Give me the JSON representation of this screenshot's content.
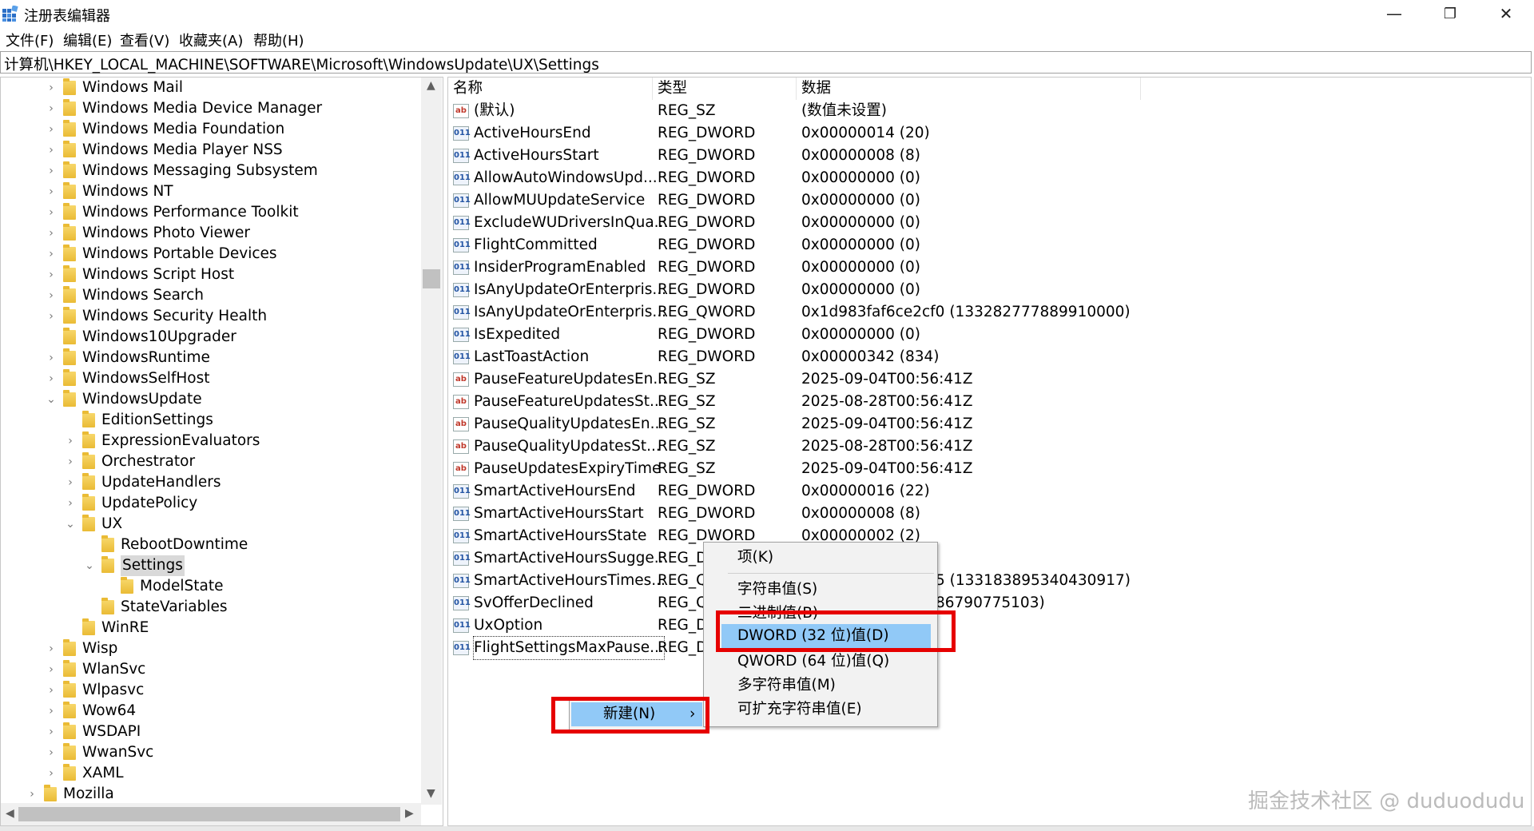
{
  "window": {
    "title": "注册表编辑器",
    "minimize": "—",
    "restore": "❐",
    "close": "✕"
  },
  "menu": [
    "文件(F)",
    "编辑(E)",
    "查看(V)",
    "收藏夹(A)",
    "帮助(H)"
  ],
  "address": "计算机\\HKEY_LOCAL_MACHINE\\SOFTWARE\\Microsoft\\WindowsUpdate\\UX\\Settings",
  "tree": [
    {
      "label": "Windows Mail",
      "level": 2,
      "expander": "›"
    },
    {
      "label": "Windows Media Device Manager",
      "level": 2,
      "expander": "›"
    },
    {
      "label": "Windows Media Foundation",
      "level": 2,
      "expander": "›"
    },
    {
      "label": "Windows Media Player NSS",
      "level": 2,
      "expander": "›"
    },
    {
      "label": "Windows Messaging Subsystem",
      "level": 2,
      "expander": "›"
    },
    {
      "label": "Windows NT",
      "level": 2,
      "expander": "›"
    },
    {
      "label": "Windows Performance Toolkit",
      "level": 2,
      "expander": "›"
    },
    {
      "label": "Windows Photo Viewer",
      "level": 2,
      "expander": "›"
    },
    {
      "label": "Windows Portable Devices",
      "level": 2,
      "expander": "›"
    },
    {
      "label": "Windows Script Host",
      "level": 2,
      "expander": "›"
    },
    {
      "label": "Windows Search",
      "level": 2,
      "expander": "›"
    },
    {
      "label": "Windows Security Health",
      "level": 2,
      "expander": "›"
    },
    {
      "label": "Windows10Upgrader",
      "level": 2,
      "expander": ""
    },
    {
      "label": "WindowsRuntime",
      "level": 2,
      "expander": "›"
    },
    {
      "label": "WindowsSelfHost",
      "level": 2,
      "expander": "›"
    },
    {
      "label": "WindowsUpdate",
      "level": 2,
      "expander": "⌄"
    },
    {
      "label": "EditionSettings",
      "level": 3,
      "expander": ""
    },
    {
      "label": "ExpressionEvaluators",
      "level": 3,
      "expander": "›"
    },
    {
      "label": "Orchestrator",
      "level": 3,
      "expander": "›"
    },
    {
      "label": "UpdateHandlers",
      "level": 3,
      "expander": "›"
    },
    {
      "label": "UpdatePolicy",
      "level": 3,
      "expander": "›"
    },
    {
      "label": "UX",
      "level": 3,
      "expander": "⌄"
    },
    {
      "label": "RebootDowntime",
      "level": 4,
      "expander": ""
    },
    {
      "label": "Settings",
      "level": 4,
      "expander": "⌄",
      "selected": true
    },
    {
      "label": "ModelState",
      "level": 5,
      "expander": ""
    },
    {
      "label": "StateVariables",
      "level": 4,
      "expander": ""
    },
    {
      "label": "WinRE",
      "level": 3,
      "expander": ""
    },
    {
      "label": "Wisp",
      "level": 2,
      "expander": "›"
    },
    {
      "label": "WlanSvc",
      "level": 2,
      "expander": "›"
    },
    {
      "label": "Wlpasvc",
      "level": 2,
      "expander": "›"
    },
    {
      "label": "Wow64",
      "level": 2,
      "expander": "›"
    },
    {
      "label": "WSDAPI",
      "level": 2,
      "expander": "›"
    },
    {
      "label": "WwanSvc",
      "level": 2,
      "expander": "›"
    },
    {
      "label": "XAML",
      "level": 2,
      "expander": "›"
    },
    {
      "label": "Mozilla",
      "level": 1,
      "expander": "›"
    }
  ],
  "columns": {
    "name": "名称",
    "type": "类型",
    "data": "数据"
  },
  "values": [
    {
      "icon": "ab",
      "name": "(默认)",
      "type": "REG_SZ",
      "data": "(数值未设置)"
    },
    {
      "icon": "bin",
      "name": "ActiveHoursEnd",
      "type": "REG_DWORD",
      "data": "0x00000014 (20)"
    },
    {
      "icon": "bin",
      "name": "ActiveHoursStart",
      "type": "REG_DWORD",
      "data": "0x00000008 (8)"
    },
    {
      "icon": "bin",
      "name": "AllowAutoWindowsUpd...",
      "type": "REG_DWORD",
      "data": "0x00000000 (0)"
    },
    {
      "icon": "bin",
      "name": "AllowMUUpdateService",
      "type": "REG_DWORD",
      "data": "0x00000000 (0)"
    },
    {
      "icon": "bin",
      "name": "ExcludeWUDriversInQua...",
      "type": "REG_DWORD",
      "data": "0x00000000 (0)"
    },
    {
      "icon": "bin",
      "name": "FlightCommitted",
      "type": "REG_DWORD",
      "data": "0x00000000 (0)"
    },
    {
      "icon": "bin",
      "name": "InsiderProgramEnabled",
      "type": "REG_DWORD",
      "data": "0x00000000 (0)"
    },
    {
      "icon": "bin",
      "name": "IsAnyUpdateOrEnterpris...",
      "type": "REG_DWORD",
      "data": "0x00000000 (0)"
    },
    {
      "icon": "bin",
      "name": "IsAnyUpdateOrEnterpris...",
      "type": "REG_QWORD",
      "data": "0x1d983faf6ce2cf0 (133282777889910000)"
    },
    {
      "icon": "bin",
      "name": "IsExpedited",
      "type": "REG_DWORD",
      "data": "0x00000000 (0)"
    },
    {
      "icon": "bin",
      "name": "LastToastAction",
      "type": "REG_DWORD",
      "data": "0x00000342 (834)"
    },
    {
      "icon": "ab",
      "name": "PauseFeatureUpdatesEn...",
      "type": "REG_SZ",
      "data": "2025-09-04T00:56:41Z"
    },
    {
      "icon": "ab",
      "name": "PauseFeatureUpdatesSt...",
      "type": "REG_SZ",
      "data": "2025-08-28T00:56:41Z"
    },
    {
      "icon": "ab",
      "name": "PauseQualityUpdatesEn...",
      "type": "REG_SZ",
      "data": "2025-09-04T00:56:41Z"
    },
    {
      "icon": "ab",
      "name": "PauseQualityUpdatesSt...",
      "type": "REG_SZ",
      "data": "2025-08-28T00:56:41Z"
    },
    {
      "icon": "ab",
      "name": "PauseUpdatesExpiryTime",
      "type": "REG_SZ",
      "data": "2025-09-04T00:56:41Z"
    },
    {
      "icon": "bin",
      "name": "SmartActiveHoursEnd",
      "type": "REG_DWORD",
      "data": "0x00000016 (22)"
    },
    {
      "icon": "bin",
      "name": "SmartActiveHoursStart",
      "type": "REG_DWORD",
      "data": "0x00000008 (8)"
    },
    {
      "icon": "bin",
      "name": "SmartActiveHoursState",
      "type": "REG_DWORD",
      "data": "0x00000002 (2)"
    },
    {
      "icon": "bin",
      "name": "SmartActiveHoursSugge...",
      "type": "REG_D",
      "data": ""
    },
    {
      "icon": "bin",
      "name": "SmartActiveHoursTimes...",
      "type": "REG_Q",
      "data": "5 (133183895340430917)"
    },
    {
      "icon": "bin",
      "name": "SvOfferDeclined",
      "type": "REG_Q",
      "data": "86790775103)"
    },
    {
      "icon": "bin",
      "name": "UxOption",
      "type": "REG_D",
      "data": ""
    },
    {
      "icon": "bin",
      "name": "FlightSettingsMaxPause...",
      "type": "REG_D",
      "data": "",
      "focused": true
    }
  ],
  "context_menu": {
    "new_label": "新建(N)",
    "submenu_arrow": "›",
    "items": [
      "项(K)",
      "字符串值(S)",
      "二进制值(B)",
      "DWORD (32 位)值(D)",
      "QWORD (64 位)值(Q)",
      "多字符串值(M)",
      "可扩充字符串值(E)"
    ],
    "highlighted_index": 3
  },
  "watermark": "掘金技术社区 @ duduodudu",
  "colors": {
    "highlight": "#91c9f7",
    "annotation_red": "#e60000",
    "folder": "#eabb35"
  }
}
